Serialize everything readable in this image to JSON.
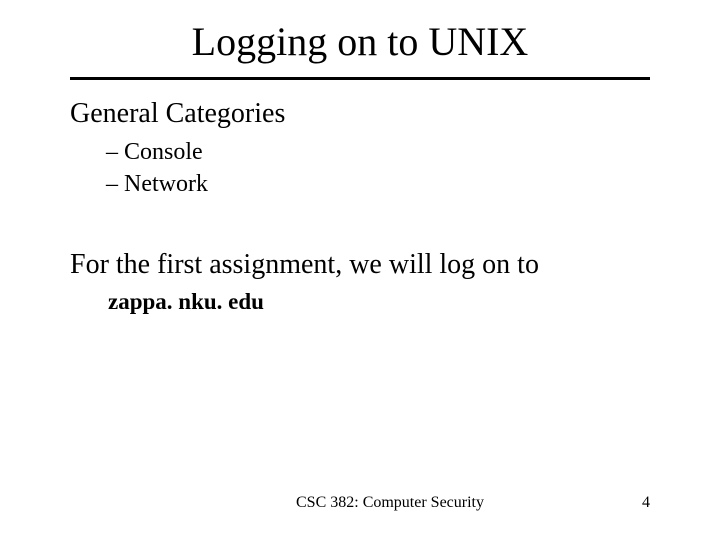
{
  "title": "Logging on to UNIX",
  "section1_heading": "General Categories",
  "bullets": {
    "0": "– Console",
    "1": "– Network"
  },
  "section2_heading": "For the first assignment, we will log on to",
  "host": "zappa. nku. edu",
  "footer": {
    "course": "CSC 382: Computer Security",
    "page": "4"
  }
}
